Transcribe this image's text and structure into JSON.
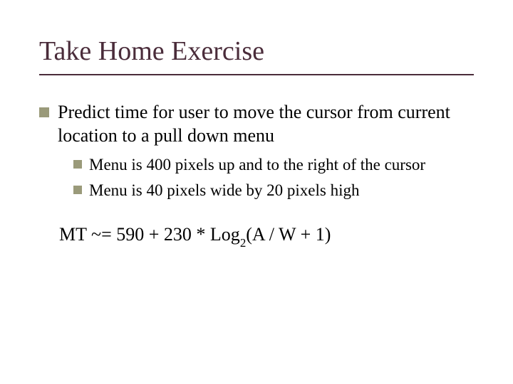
{
  "title": "Take Home Exercise",
  "main_bullet": "Predict time for user to move the cursor from current location to a pull down menu",
  "sub_bullets": [
    "Menu is 400 pixels up and to the right of the cursor",
    "Menu is 40 pixels wide by 20 pixels high"
  ],
  "equation_prefix": "MT ~= 590 + 230 * Log",
  "equation_sub": "2",
  "equation_suffix": "(A / W + 1)"
}
